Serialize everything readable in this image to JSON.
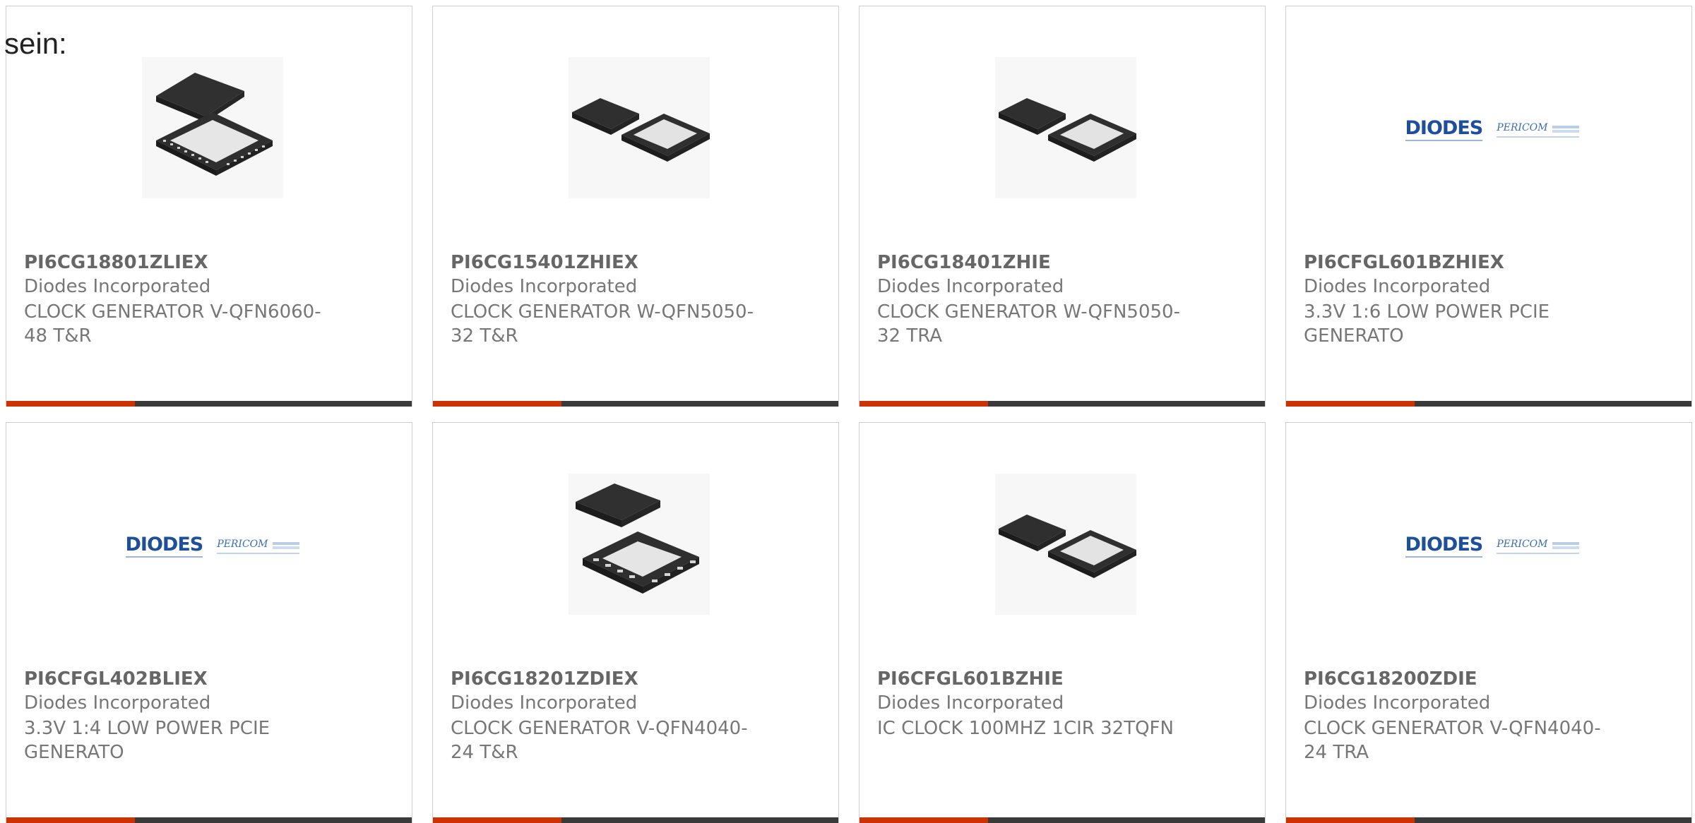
{
  "intro_text": "sein:",
  "colors": {
    "accent": "#cc3300",
    "bar": "#3a3a3a",
    "border": "#cfcfcf"
  },
  "products": [
    {
      "part": "PI6CG18801ZLIEX",
      "maker": "Diodes Incorporated",
      "desc": "CLOCK GENERATOR V-QFN6060-48 T&R",
      "image": "qfn-48-chip",
      "image_alt": "QFN48 package photo"
    },
    {
      "part": "PI6CG15401ZHIEX",
      "maker": "Diodes Incorporated",
      "desc": "CLOCK GENERATOR W-QFN5050-32 T&R",
      "image": "qfn-32-chip",
      "image_alt": "QFN32 package photo"
    },
    {
      "part": "PI6CG18401ZHIE",
      "maker": "Diodes Incorporated",
      "desc": "CLOCK GENERATOR W-QFN5050-32 TRA",
      "image": "qfn-32-chip",
      "image_alt": "QFN32 package photo"
    },
    {
      "part": "PI6CFGL601BZHIEX",
      "maker": "Diodes Incorporated",
      "desc": "3.3V 1:6 LOW POWER PCIE GENERATO",
      "image": "diodes-pericom-logo",
      "image_alt": "DIODES PERICOM logo"
    },
    {
      "part": "PI6CFGL402BLIEX",
      "maker": "Diodes Incorporated",
      "desc": "3.3V 1:4 LOW POWER PCIE GENERATO",
      "image": "diodes-pericom-logo",
      "image_alt": "DIODES PERICOM logo"
    },
    {
      "part": "PI6CG18201ZDIEX",
      "maker": "Diodes Incorporated",
      "desc": "CLOCK GENERATOR V-QFN4040-24 T&R",
      "image": "qfn-24-chip",
      "image_alt": "QFN24 package photo"
    },
    {
      "part": "PI6CFGL601BZHIE",
      "maker": "Diodes Incorporated",
      "desc": "IC CLOCK 100MHZ 1CIR 32TQFN",
      "image": "qfn-32-chip",
      "image_alt": "QFN32 package photo"
    },
    {
      "part": "PI6CG18200ZDIE",
      "maker": "Diodes Incorporated",
      "desc": "CLOCK GENERATOR V-QFN4040-24 TRA",
      "image": "diodes-pericom-logo",
      "image_alt": "DIODES PERICOM logo"
    }
  ],
  "logo": {
    "brand": "DIODES",
    "sub": "PERICOM"
  }
}
